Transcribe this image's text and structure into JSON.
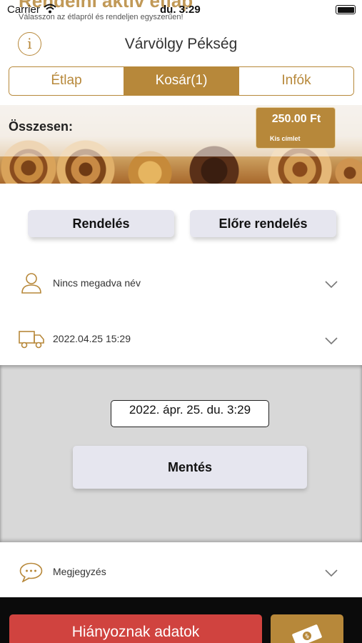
{
  "background_banner": {
    "title": "Rendelni aktiv étlap",
    "subtitle": "Válasszon az étlapról és rendeljen egyszerűen!"
  },
  "status_bar": {
    "carrier": "Carrier",
    "time": "du. 3:29",
    "icons": [
      "wifi-icon",
      "battery-icon"
    ]
  },
  "header": {
    "info_icon": "i",
    "title": "Várvölgy Pékség"
  },
  "tabs": [
    {
      "label": "Étlap",
      "active": false
    },
    {
      "label": "Kosár(1)",
      "active": true
    },
    {
      "label": "Infók",
      "active": false
    }
  ],
  "summary": {
    "total_label": "Összesen:",
    "price": "250.00 Ft",
    "price_note": "Kis címlet"
  },
  "order_buttons": {
    "order": "Rendelés",
    "preorder": "Előre rendelés"
  },
  "rows": {
    "name": {
      "text": "Nincs megadva név",
      "icon": "person-icon"
    },
    "delivery": {
      "text": "2022.04.25 15:29",
      "icon": "truck-icon"
    },
    "note": {
      "text": "Megjegyzés",
      "icon": "chat-bubble-icon"
    }
  },
  "picker": {
    "datetime": "2022. ápr. 25. du. 3:29",
    "save": "Mentés"
  },
  "bottom": {
    "missing_data": "Hiányoznak adatok",
    "pay_icon": "cash-icon"
  },
  "colors": {
    "accent": "#b7883a",
    "error": "#d0433f",
    "button_bg": "#e6e6ef"
  }
}
